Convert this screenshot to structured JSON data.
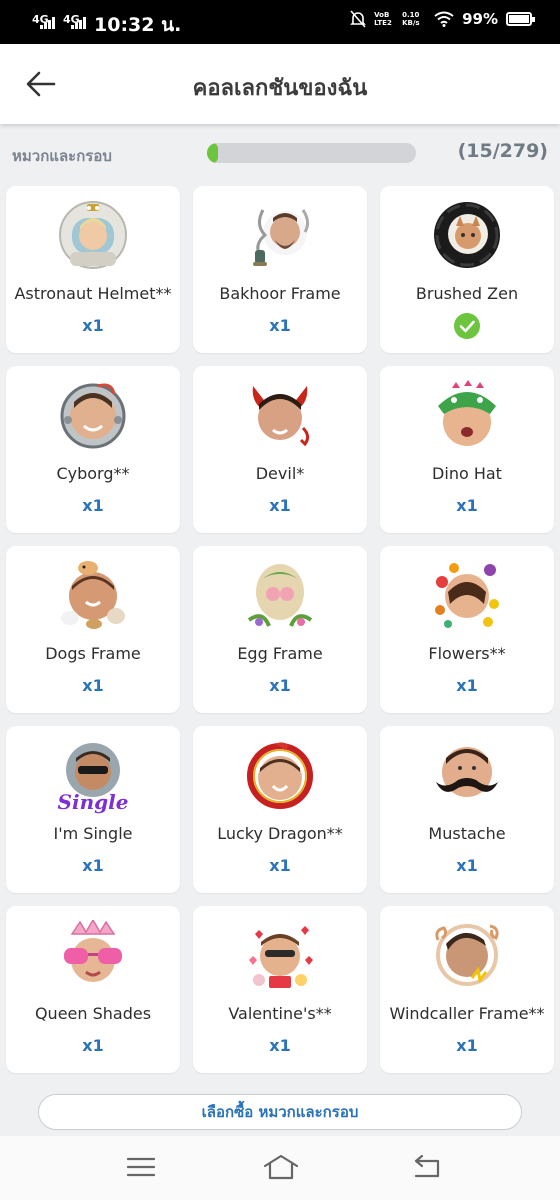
{
  "status_bar": {
    "network1": "4G",
    "network2": "4G",
    "time": "10:32 น.",
    "volte": "VoB LTE2",
    "speed": "0.10 KB/s",
    "battery": "99%"
  },
  "header": {
    "title": "คอลเลกชันของฉัน",
    "back_icon": "arrow-left-icon"
  },
  "collection": {
    "label": "หมวกและกรอบ",
    "count": "(15/279)",
    "progress": 0.054
  },
  "items": [
    {
      "name": "Astronaut Helmet**",
      "qty": "x1",
      "icon": "astronaut-helmet-avatar-icon"
    },
    {
      "name": "Bakhoor Frame",
      "qty": "x1",
      "icon": "bakhoor-frame-avatar-icon"
    },
    {
      "name": "Brushed Zen",
      "qty": "",
      "owned_check": true,
      "icon": "brushed-zen-avatar-icon"
    },
    {
      "name": "Cyborg**",
      "qty": "x1",
      "icon": "cyborg-avatar-icon"
    },
    {
      "name": "Devil*",
      "qty": "x1",
      "icon": "devil-avatar-icon"
    },
    {
      "name": "Dino Hat",
      "qty": "x1",
      "icon": "dino-hat-avatar-icon"
    },
    {
      "name": "Dogs Frame",
      "qty": "x1",
      "icon": "dogs-frame-avatar-icon"
    },
    {
      "name": "Egg Frame",
      "qty": "x1",
      "icon": "egg-frame-avatar-icon"
    },
    {
      "name": "Flowers**",
      "qty": "x1",
      "icon": "flowers-avatar-icon"
    },
    {
      "name": "I'm Single",
      "qty": "x1",
      "badge": "Single",
      "icon": "im-single-avatar-icon"
    },
    {
      "name": "Lucky Dragon**",
      "qty": "x1",
      "icon": "lucky-dragon-avatar-icon"
    },
    {
      "name": "Mustache",
      "qty": "x1",
      "icon": "mustache-avatar-icon"
    },
    {
      "name": "Queen Shades",
      "qty": "x1",
      "icon": "queen-shades-avatar-icon"
    },
    {
      "name": "Valentine's**",
      "qty": "x1",
      "icon": "valentines-avatar-icon"
    },
    {
      "name": "Windcaller Frame**",
      "qty": "x1",
      "icon": "windcaller-frame-avatar-icon"
    }
  ],
  "shop_button": "เลือกซื้อ หมวกและกรอบ",
  "colors": {
    "accent_blue": "#2a73b9",
    "progress_green": "#6cc43f",
    "background": "#eef0f2"
  }
}
